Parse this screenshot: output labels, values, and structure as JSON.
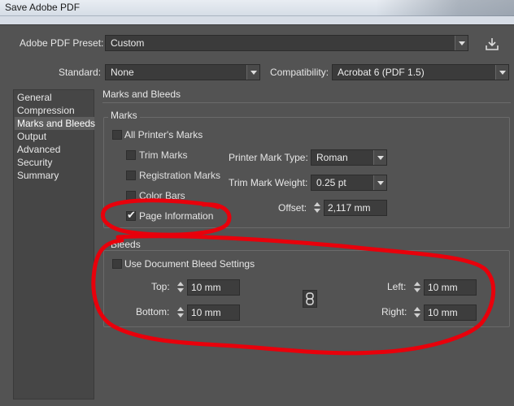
{
  "window": {
    "title": "Save Adobe PDF"
  },
  "preset": {
    "label": "Adobe PDF Preset:",
    "value": "Custom"
  },
  "standard": {
    "label": "Standard:",
    "value": "None"
  },
  "compatibility": {
    "label": "Compatibility:",
    "value": "Acrobat 6 (PDF 1.5)"
  },
  "sidebar": {
    "items": [
      {
        "label": "General"
      },
      {
        "label": "Compression"
      },
      {
        "label": "Marks and Bleeds"
      },
      {
        "label": "Output"
      },
      {
        "label": "Advanced"
      },
      {
        "label": "Security"
      },
      {
        "label": "Summary"
      }
    ],
    "selected": "Marks and Bleeds"
  },
  "main": {
    "title": "Marks and Bleeds"
  },
  "marks": {
    "title": "Marks",
    "all_printers_marks": {
      "label": "All Printer's Marks",
      "checked": false
    },
    "trim_marks": {
      "label": "Trim Marks",
      "checked": false
    },
    "registration_marks": {
      "label": "Registration Marks",
      "checked": false
    },
    "color_bars": {
      "label": "Color Bars",
      "checked": false
    },
    "page_information": {
      "label": "Page Information",
      "checked": true
    },
    "printer_mark_type": {
      "label": "Printer Mark Type:",
      "value": "Roman"
    },
    "trim_mark_weight": {
      "label": "Trim Mark Weight:",
      "value": "0.25 pt"
    },
    "offset": {
      "label": "Offset:",
      "value": "2,117 mm"
    }
  },
  "bleeds": {
    "title": "Bleeds",
    "use_document": {
      "label": "Use Document Bleed Settings",
      "checked": false
    },
    "top": {
      "label": "Top:",
      "value": "10 mm"
    },
    "bottom": {
      "label": "Bottom:",
      "value": "10 mm"
    },
    "left": {
      "label": "Left:",
      "value": "10 mm"
    },
    "right": {
      "label": "Right:",
      "value": "10 mm"
    }
  },
  "icons": {
    "save_preset": "save-preset-icon",
    "chain": "chain-link-icon",
    "checkmark": "checkmark-icon"
  },
  "annotation": {
    "color": "#e8000b"
  }
}
